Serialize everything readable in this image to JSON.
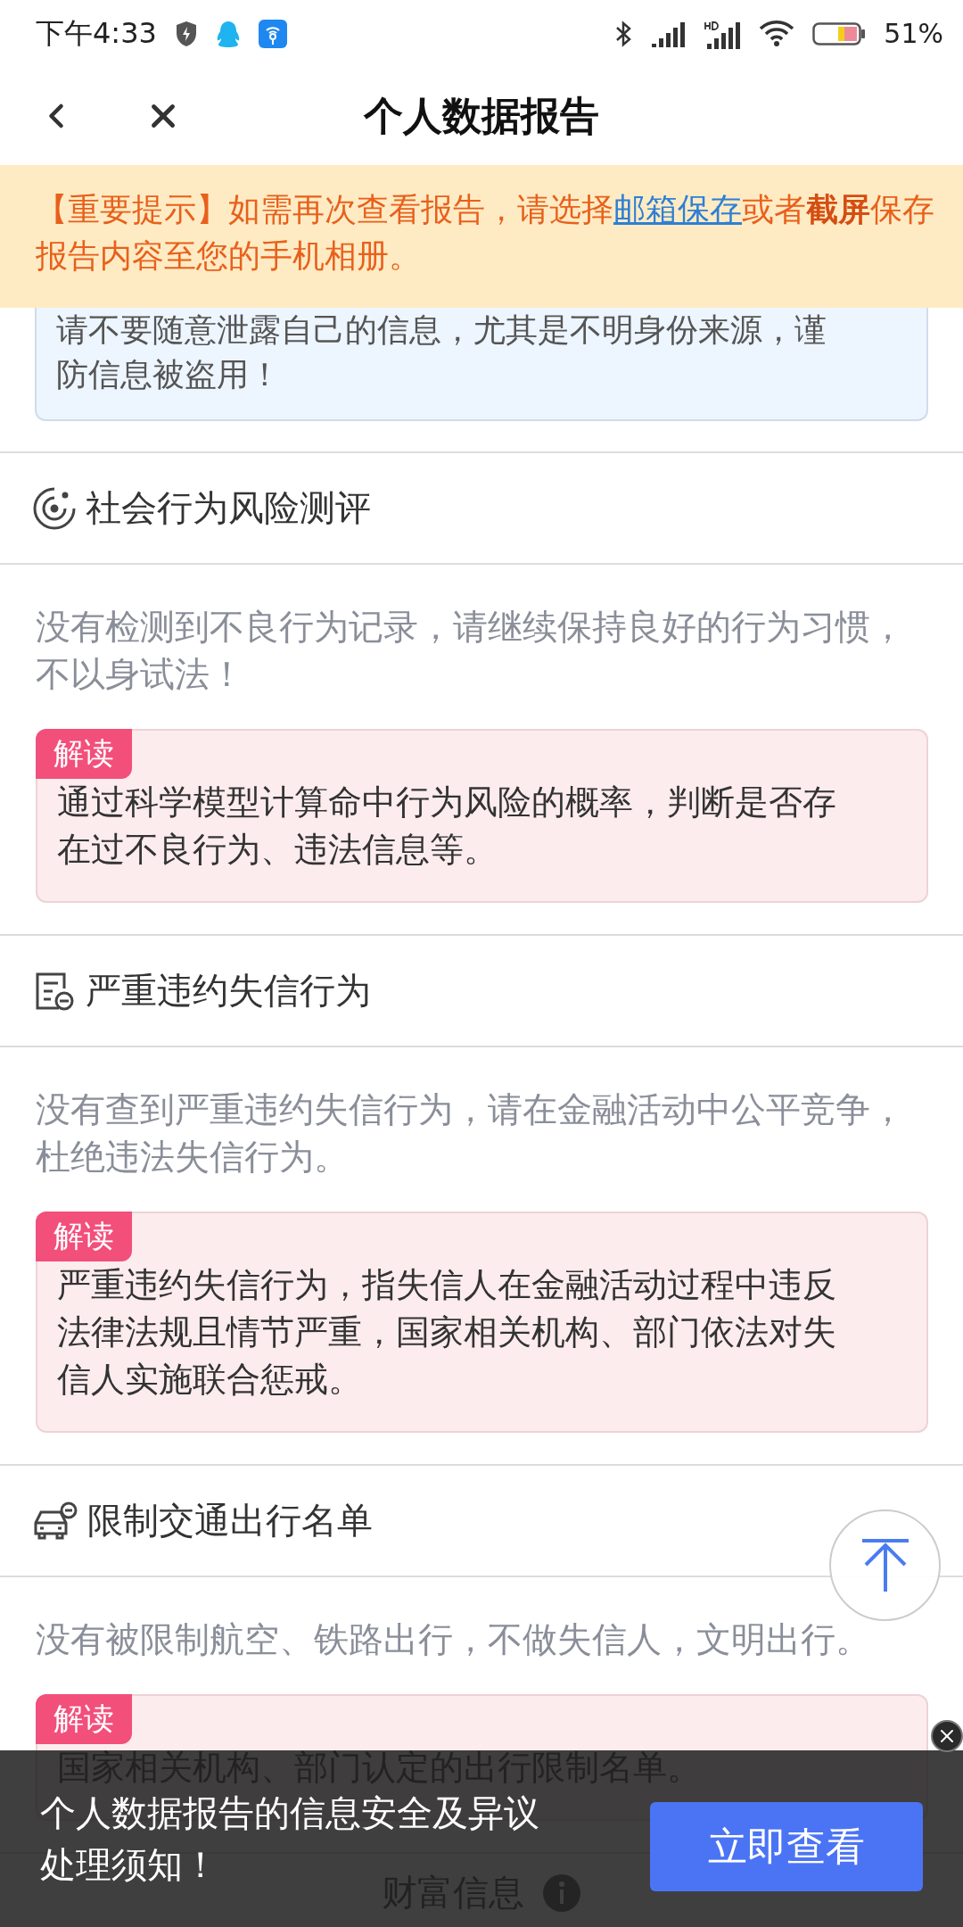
{
  "status_bar": {
    "time": "下午4:33",
    "battery": "51%"
  },
  "nav": {
    "title": "个人数据报告"
  },
  "notice": {
    "before": "【重要提示】如需再次查看报告，请选择",
    "link": "邮箱保存",
    "after": "或者**截屏**保存报告内容至您的手机相册。"
  },
  "warning_card": {
    "text": "请不要随意泄露自己的信息，尤其是不明身份来源，谨防信息被盗用！"
  },
  "sections": [
    {
      "kind": "radar",
      "title": "社会行为风险测评",
      "result": "没有检测到不良行为记录，请继续保持良好的行为习惯，不以身试法！",
      "tag": "解读",
      "interpretation": "通过科学模型计算命中行为风险的概率，判断是否存在过不良行为、违法信息等。"
    },
    {
      "kind": "document",
      "title": "严重违约失信行为",
      "result": "没有查到严重违约失信行为，请在金融活动中公平竞争，杜绝违法失信行为。",
      "tag": "解读",
      "interpretation": "严重违约失信行为，指失信人在金融活动过程中违反法律法规且情节严重，国家相关机构、部门依法对失信人实施联合惩戒。"
    },
    {
      "kind": "car",
      "title": "限制交通出行名单",
      "result": "没有被限制航空、铁路出行，不做失信人，文明出行。",
      "tag": "解读",
      "interpretation": "国家相关机构、部门认定的出行限制名单。"
    }
  ],
  "next_section": {
    "title": "财富信息"
  },
  "bottom_popup": {
    "text": "个人数据报告的信息安全及异议处理须知！",
    "button": "立即查看"
  }
}
